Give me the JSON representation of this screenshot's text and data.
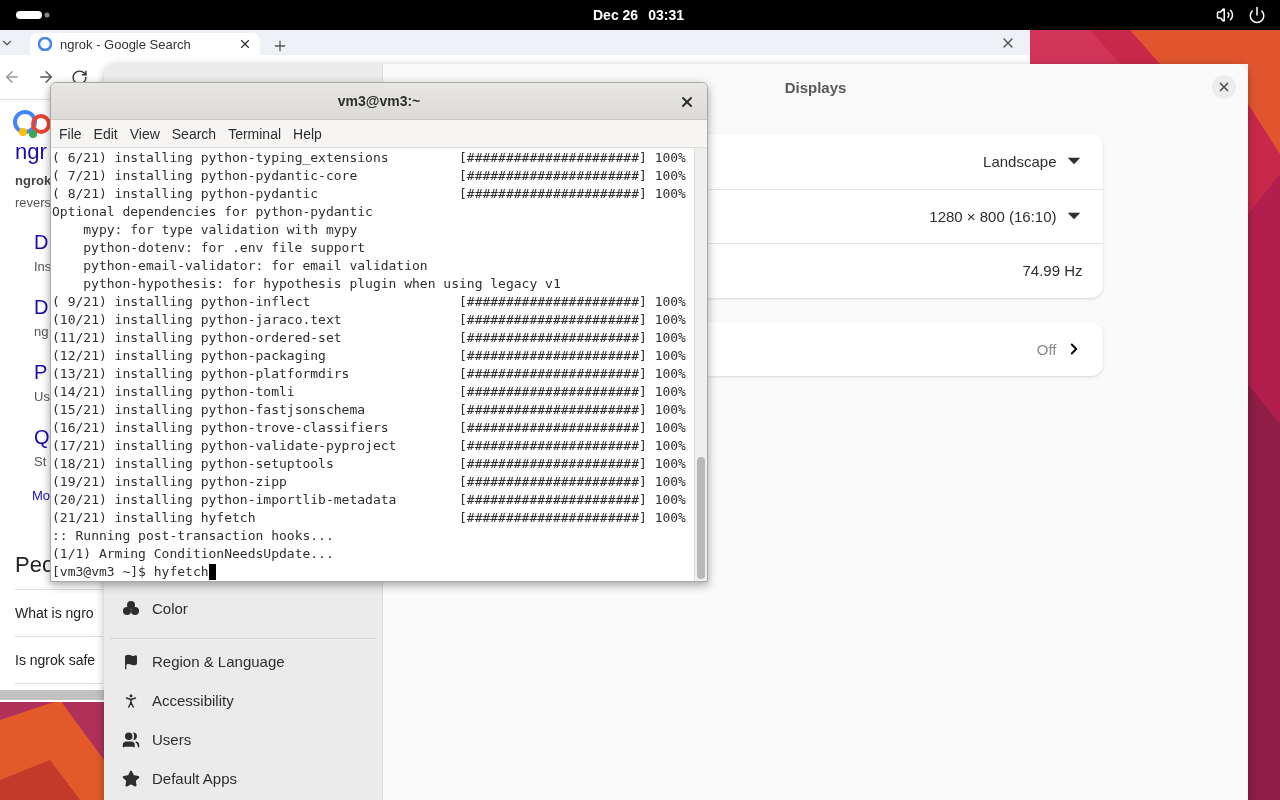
{
  "top_bar": {
    "date": "Dec 26",
    "time": "03:31"
  },
  "browser": {
    "tab": {
      "title": "ngrok - Google Search"
    },
    "results_header": {
      "query_heading": "ngr",
      "source": "ngrok",
      "snippet": "revers"
    },
    "results": [
      {
        "title": "D",
        "snippet": "Ins"
      },
      {
        "title": "D",
        "snippet": "ng"
      },
      {
        "title": "P",
        "snippet": "Us"
      },
      {
        "title": "Q",
        "snippet": "St"
      }
    ],
    "more_link": "Mo",
    "section_heading": "Peo",
    "questions": [
      "What is ngro",
      "Is ngrok safe"
    ]
  },
  "settings": {
    "title": "Displays",
    "sidebar": {
      "groups": [
        [
          "Color"
        ],
        [
          "Region & Language",
          "Accessibility",
          "Users",
          "Default Apps"
        ]
      ]
    },
    "cards": [
      [
        {
          "kind": "dropdown",
          "value": "Landscape"
        },
        {
          "kind": "dropdown",
          "value": "1280 × 800 (16:10)"
        },
        {
          "kind": "plain",
          "value": "74.99 Hz"
        }
      ],
      [
        {
          "kind": "link",
          "value": "Off"
        }
      ]
    ]
  },
  "terminal": {
    "title": "vm3@vm3:~",
    "menu": [
      "File",
      "Edit",
      "View",
      "Search",
      "Terminal",
      "Help"
    ],
    "lines": [
      {
        "kind": "progress",
        "label": "( 6/21) installing python-typing_extensions",
        "bar": "[######################]",
        "percent": "100%"
      },
      {
        "kind": "progress",
        "label": "( 7/21) installing python-pydantic-core",
        "bar": "[######################]",
        "percent": "100%"
      },
      {
        "kind": "progress",
        "label": "( 8/21) installing python-pydantic",
        "bar": "[######################]",
        "percent": "100%"
      },
      {
        "kind": "text",
        "text": "Optional dependencies for python-pydantic"
      },
      {
        "kind": "detail",
        "text": "mypy: for type validation with mypy"
      },
      {
        "kind": "detail",
        "text": "python-dotenv: for .env file support"
      },
      {
        "kind": "detail",
        "text": "python-email-validator: for email validation"
      },
      {
        "kind": "detail",
        "text": "python-hypothesis: for hypothesis plugin when using legacy v1"
      },
      {
        "kind": "progress",
        "label": "( 9/21) installing python-inflect",
        "bar": "[######################]",
        "percent": "100%"
      },
      {
        "kind": "progress",
        "label": "(10/21) installing python-jaraco.text",
        "bar": "[######################]",
        "percent": "100%"
      },
      {
        "kind": "progress",
        "label": "(11/21) installing python-ordered-set",
        "bar": "[######################]",
        "percent": "100%"
      },
      {
        "kind": "progress",
        "label": "(12/21) installing python-packaging",
        "bar": "[######################]",
        "percent": "100%"
      },
      {
        "kind": "progress",
        "label": "(13/21) installing python-platformdirs",
        "bar": "[######################]",
        "percent": "100%"
      },
      {
        "kind": "progress",
        "label": "(14/21) installing python-tomli",
        "bar": "[######################]",
        "percent": "100%"
      },
      {
        "kind": "progress",
        "label": "(15/21) installing python-fastjsonschema",
        "bar": "[######################]",
        "percent": "100%"
      },
      {
        "kind": "progress",
        "label": "(16/21) installing python-trove-classifiers",
        "bar": "[######################]",
        "percent": "100%"
      },
      {
        "kind": "progress",
        "label": "(17/21) installing python-validate-pyproject",
        "bar": "[######################]",
        "percent": "100%"
      },
      {
        "kind": "progress",
        "label": "(18/21) installing python-setuptools",
        "bar": "[######################]",
        "percent": "100%"
      },
      {
        "kind": "progress",
        "label": "(19/21) installing python-zipp",
        "bar": "[######################]",
        "percent": "100%"
      },
      {
        "kind": "progress",
        "label": "(20/21) installing python-importlib-metadata",
        "bar": "[######################]",
        "percent": "100%"
      },
      {
        "kind": "progress",
        "label": "(21/21) installing hyfetch",
        "bar": "[######################]",
        "percent": "100%"
      },
      {
        "kind": "text",
        "text": ":: Running post-transaction hooks..."
      },
      {
        "kind": "text",
        "text": "(1/1) Arming ConditionNeedsUpdate..."
      },
      {
        "kind": "prompt",
        "text": "[vm3@vm3 ~]$ hyfetch"
      }
    ]
  }
}
